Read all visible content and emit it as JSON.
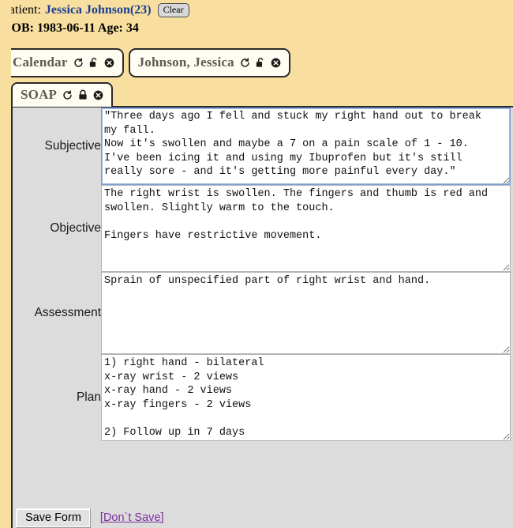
{
  "header": {
    "patient_label": "Patient:",
    "patient_name": "Jessica Johnson(23)",
    "clear_button": "Clear",
    "dob_line": "DOB: 1983-06-11 Age: 34"
  },
  "tabs": {
    "items": [
      {
        "label": "Calendar",
        "refresh_icon": "refresh-icon",
        "lock_icon": "unlocked-padlock-icon",
        "close_icon": "close-circle-icon"
      },
      {
        "label": "Johnson, Jessica",
        "refresh_icon": "refresh-icon",
        "lock_icon": "unlocked-padlock-icon",
        "close_icon": "close-circle-icon"
      }
    ],
    "inner": {
      "label": "SOAP",
      "refresh_icon": "refresh-icon",
      "lock_icon": "locked-padlock-icon",
      "close_icon": "close-circle-icon"
    }
  },
  "form": {
    "fields": [
      {
        "label": "Subjective",
        "value": "\"Three days ago I fell and stuck my right hand out to break\nmy fall.\nNow it's swollen and maybe a 7 on a pain scale of 1 - 10.\nI've been icing it and using my Ibuprofen but it's still\nreally sore - and it's getting more painful every day.\""
      },
      {
        "label": "Objective",
        "value": "The right wrist is swollen. The fingers and thumb is red and\nswollen. Slightly warm to the touch.\n\nFingers have restrictive movement."
      },
      {
        "label": "Assessment",
        "value": "Sprain of unspecified part of right wrist and hand."
      },
      {
        "label": "Plan",
        "value": "1) right hand - bilateral\nx-ray wrist - 2 views\nx-ray hand - 2 views\nx-ray fingers - 2 views\n\n2) Follow up in 7 days"
      }
    ]
  },
  "footer": {
    "save_label": "Save Form",
    "dont_save_label": "[Don`t Save]"
  },
  "colors": {
    "page_background": "#f8dfa0",
    "panel_background": "#dcdcdc",
    "tab_background": "#fffdf2",
    "link": "#1c3f94",
    "dont_save_link": "#7d30a0",
    "focus_border": "#7b9fd4",
    "border": "#2b2b2b"
  }
}
